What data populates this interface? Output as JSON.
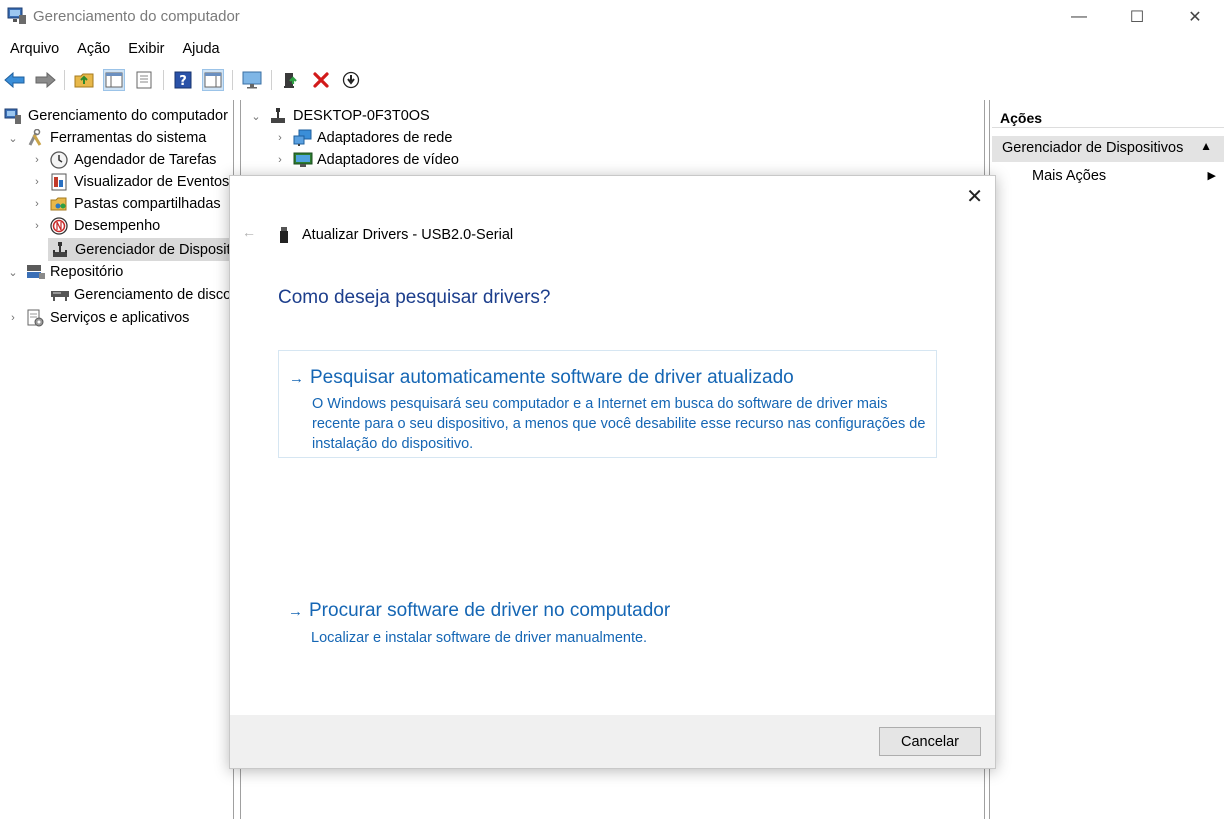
{
  "window": {
    "title": "Gerenciamento do computador",
    "minimize_glyph": "—",
    "maximize_glyph": "☐",
    "close_glyph": "✕"
  },
  "menu": [
    "Arquivo",
    "Ação",
    "Exibir",
    "Ajuda"
  ],
  "toolbar": {
    "icons": [
      "back-arrow-icon",
      "forward-arrow-icon",
      "up-folder-icon",
      "show-hide-tree-icon",
      "properties-icon",
      "help-icon",
      "show-action-pane-icon",
      "monitor-icon",
      "update-driver-icon",
      "uninstall-icon",
      "disable-device-icon"
    ]
  },
  "left_tree": {
    "root": "Gerenciamento do computador",
    "items": [
      {
        "label": "Ferramentas do sistema",
        "expanded": true
      },
      {
        "label": "Agendador de Tarefas"
      },
      {
        "label": "Visualizador de Eventos"
      },
      {
        "label": "Pastas compartilhadas"
      },
      {
        "label": "Desempenho"
      },
      {
        "label": "Gerenciador de Dispositivos",
        "selected": true
      },
      {
        "label": "Repositório",
        "expanded": true
      },
      {
        "label": "Gerenciamento de disco"
      },
      {
        "label": "Serviços e aplicativos"
      }
    ]
  },
  "device_tree": {
    "computer": "DESKTOP-0F3T0OS",
    "items": [
      "Adaptadores de rede",
      "Adaptadores de vídeo"
    ]
  },
  "actions": {
    "header": "Ações",
    "section": "Gerenciador de Dispositivos",
    "more": "Mais Ações"
  },
  "dialog": {
    "title": "Atualizar Drivers - USB2.0-Serial",
    "question": "Como deseja pesquisar drivers?",
    "option1": {
      "title": "Pesquisar automaticamente software de driver atualizado",
      "description": "O Windows pesquisará seu computador e a Internet em busca do software de driver mais recente para o seu dispositivo, a menos que você desabilite esse recurso nas configurações de instalação do dispositivo."
    },
    "option2": {
      "title": "Procurar software de driver no computador",
      "description": "Localizar e instalar software de driver manualmente."
    },
    "cancel_label": "Cancelar",
    "arrow_glyph": "→",
    "back_glyph": "←",
    "close_glyph": "✕"
  },
  "colors": {
    "link_blue": "#1566b4",
    "question_blue": "#1c3e8c",
    "selection_gray": "#d9d9d9",
    "footer_gray": "#f0f0f0"
  }
}
